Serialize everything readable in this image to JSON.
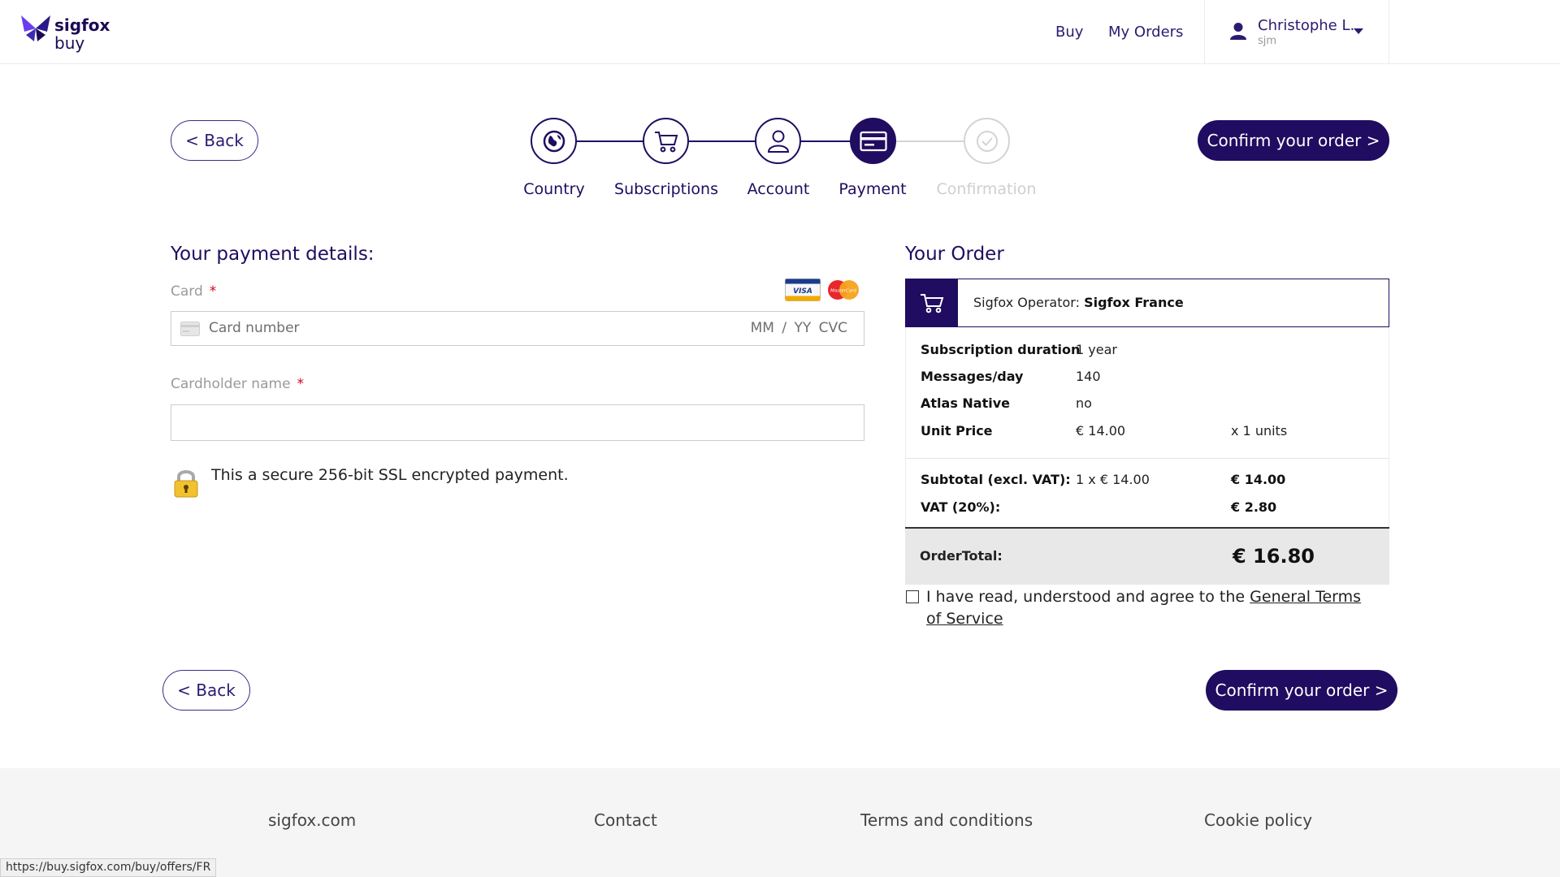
{
  "header": {
    "logo_line1": "sigfox",
    "logo_line2": "buy",
    "nav_buy": "Buy",
    "nav_orders": "My Orders",
    "user_name": "Christophe L.",
    "user_sub": "sjm"
  },
  "actions": {
    "back_label": "< Back",
    "confirm_label": "Confirm your order >"
  },
  "steps": [
    {
      "label": "Country",
      "icon": "globe-icon",
      "state": "done"
    },
    {
      "label": "Subscriptions",
      "icon": "cart-icon",
      "state": "done"
    },
    {
      "label": "Account",
      "icon": "user-icon",
      "state": "done"
    },
    {
      "label": "Payment",
      "icon": "credit-card-icon",
      "state": "active"
    },
    {
      "label": "Confirmation",
      "icon": "check-circle-icon",
      "state": "inactive"
    }
  ],
  "payment": {
    "title": "Your payment details:",
    "card_label": "Card",
    "required_mark": "*",
    "card_placeholder": "Card number",
    "card_expiry_cvc": "MM / YY  CVC",
    "cardholder_label": "Cardholder name",
    "secure_text": "This a secure 256-bit SSL encrypted payment.",
    "card_brands": [
      "VISA",
      "MasterCard"
    ]
  },
  "order": {
    "title": "Your Order",
    "operator_label": "Sigfox Operator:",
    "operator_value": "Sigfox France",
    "details": [
      {
        "key": "Subscription duration",
        "value": "1 year",
        "extra": ""
      },
      {
        "key": "Messages/day",
        "value": "140",
        "extra": ""
      },
      {
        "key": "Atlas Native",
        "value": "no",
        "extra": ""
      },
      {
        "key": "Unit Price",
        "value": "€ 14.00",
        "extra": "x 1 units"
      }
    ],
    "subtotal_label": "Subtotal (excl. VAT):",
    "subtotal_calc": "1 x € 14.00",
    "subtotal_value": "€ 14.00",
    "vat_label": "VAT (20%):",
    "vat_value": "€ 2.80",
    "total_label": "OrderTotal:",
    "total_value": "€ 16.80",
    "tos_text": "I have read, understood and agree to the ",
    "tos_link": "General Terms of Service"
  },
  "footer": {
    "links": [
      "sigfox.com",
      "Contact",
      "Terms and conditions",
      "Cookie policy"
    ]
  },
  "status_url": "https://buy.sigfox.com/buy/offers/FR",
  "colors": {
    "brand": "#200c60",
    "required": "#d0021b",
    "inactive": "#cfcfcf"
  }
}
